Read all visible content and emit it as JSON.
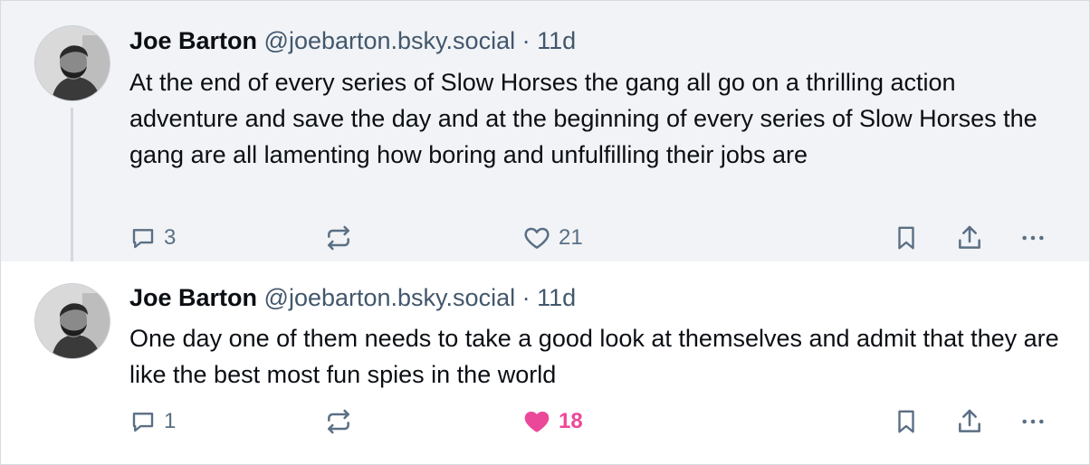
{
  "posts": [
    {
      "author": {
        "display_name": "Joe Barton",
        "handle": "@joebarton.bsky.social"
      },
      "separator": "·",
      "time": "11d",
      "text": "At the end of every series of Slow Horses the gang all go on a thrilling action adventure and save the day and at the beginning of every series of Slow Horses the gang are all lamenting how boring and unfulfilling their jobs are",
      "reply_count": "3",
      "like_count": "21",
      "liked": false
    },
    {
      "author": {
        "display_name": "Joe Barton",
        "handle": "@joebarton.bsky.social"
      },
      "separator": "·",
      "time": "11d",
      "text": "One day one of them needs to take a good look at themselves and admit that they are like the best most fun spies in the world",
      "reply_count": "1",
      "like_count": "18",
      "liked": true
    }
  ],
  "icons": {
    "reply": "speech-bubble-icon",
    "repost": "repost-icon",
    "like": "heart-icon",
    "bookmark": "bookmark-icon",
    "share": "share-icon",
    "more": "more-dots-icon"
  },
  "colors": {
    "icon": "#5a6f84",
    "liked": "#ec4899",
    "parent_background": "#f1f3f6"
  }
}
